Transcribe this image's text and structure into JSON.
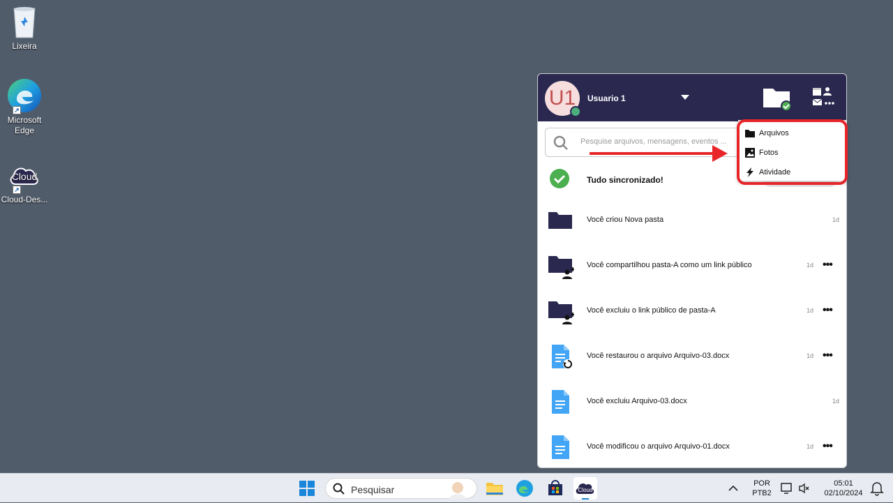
{
  "desktop": {
    "icons": [
      {
        "label": "Lixeira"
      },
      {
        "label": "Microsoft Edge"
      },
      {
        "label": "Cloud-Des..."
      }
    ]
  },
  "panel": {
    "user_initials": "U1",
    "user_name": "Usuario 1",
    "search_placeholder": "Pesquise arquivos, mensagens, eventos ...",
    "sync_status": "Tudo sincronizado!",
    "activities": [
      {
        "text": "Você criou Nova pasta",
        "time": "1d",
        "icon": "folder-icon",
        "has_more": false
      },
      {
        "text": "Você compartilhou pasta-A como um link público",
        "time": "1d",
        "icon": "folder-share-icon",
        "has_more": true
      },
      {
        "text": "Você excluiu o link público de pasta-A",
        "time": "1d",
        "icon": "folder-share-icon",
        "has_more": true
      },
      {
        "text": "Você restaurou o arquivo Arquivo-03.docx",
        "time": "1d",
        "icon": "file-restore-icon",
        "has_more": true
      },
      {
        "text": "Você excluiu Arquivo-03.docx",
        "time": "1d",
        "icon": "file-icon",
        "has_more": false
      },
      {
        "text": "Você modificou o arquivo Arquivo-01.docx",
        "time": "1d",
        "icon": "file-icon",
        "has_more": true
      }
    ],
    "more_dots": "•••"
  },
  "menu": {
    "items": [
      {
        "label": "Arquivos",
        "icon": "folder-icon"
      },
      {
        "label": "Fotos",
        "icon": "image-icon"
      },
      {
        "label": "Atividade",
        "icon": "lightning-icon"
      }
    ]
  },
  "taskbar": {
    "search_label": "Pesquisar",
    "lang_line1": "POR",
    "lang_line2": "PTB2",
    "time": "05:01",
    "date": "02/10/2024",
    "cloud_label": "Cloud"
  },
  "colors": {
    "header": "#2b2850",
    "accent_green": "#4caf50",
    "file_blue": "#42a5f5",
    "annotation_red": "#e8262a"
  }
}
